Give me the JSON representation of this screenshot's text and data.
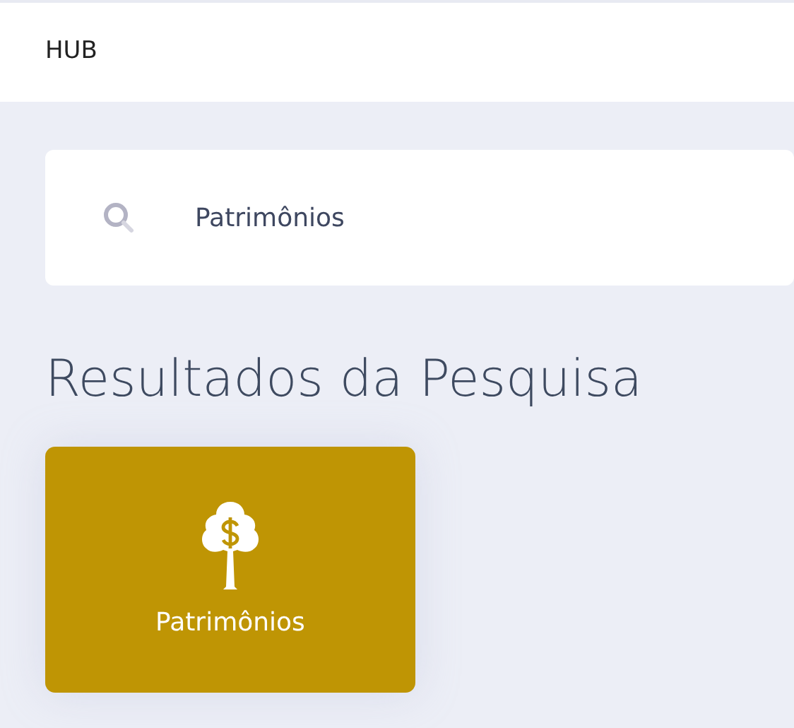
{
  "header": {
    "title": "HUB"
  },
  "search": {
    "value": "Patrimônios"
  },
  "results": {
    "title": "Resultados da Pesquisa",
    "items": [
      {
        "label": "Patrimônios",
        "color": "#bf9504"
      }
    ]
  }
}
